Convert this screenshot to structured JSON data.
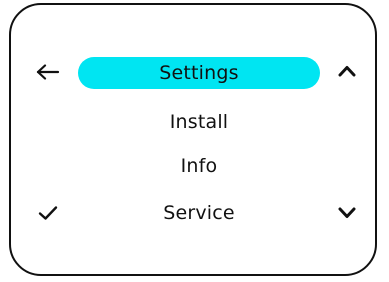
{
  "menu": {
    "items": [
      {
        "label": "Settings",
        "selected": true
      },
      {
        "label": "Install",
        "selected": false
      },
      {
        "label": "Info",
        "selected": false
      },
      {
        "label": "Service",
        "selected": false
      }
    ]
  },
  "icons": {
    "back": "arrow-left-icon",
    "up": "chevron-up-icon",
    "down": "chevron-down-icon",
    "confirm": "checkmark-icon"
  },
  "colors": {
    "highlight": "#00e5f2",
    "foreground": "#111111",
    "background": "#ffffff"
  }
}
